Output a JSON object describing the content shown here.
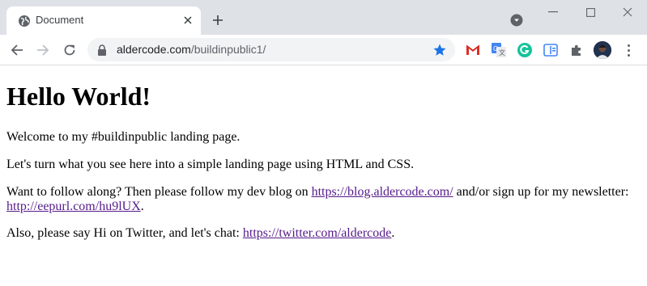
{
  "browser": {
    "tab": {
      "title": "Document"
    },
    "address_bar": {
      "host": "aldercode.com",
      "path": "/buildinpublic1/"
    },
    "extensions": [
      "gmail-icon",
      "google-translate-icon",
      "grammarly-icon",
      "extension-icon",
      "puzzle-icon"
    ]
  },
  "page": {
    "heading": "Hello World!",
    "intro": "Welcome to my #buildinpublic landing page.",
    "plan": "Let's turn what you see here into a simple landing page using HTML and CSS.",
    "follow": {
      "text_before": "Want to follow along? Then please follow my dev blog on ",
      "blog_link": "https://blog.aldercode.com/",
      "text_middle": " and/or sign up for my newsletter: ",
      "newsletter_link": "http://eepurl.com/hu9lUX",
      "text_after": "."
    },
    "twitter": {
      "text_before": "Also, please say Hi on Twitter, and let's chat: ",
      "link": "https://twitter.com/aldercode",
      "text_after": "."
    }
  },
  "colors": {
    "tabstrip": "#dee1e6",
    "link_visited": "#551a8b",
    "star": "#1a73e8"
  }
}
